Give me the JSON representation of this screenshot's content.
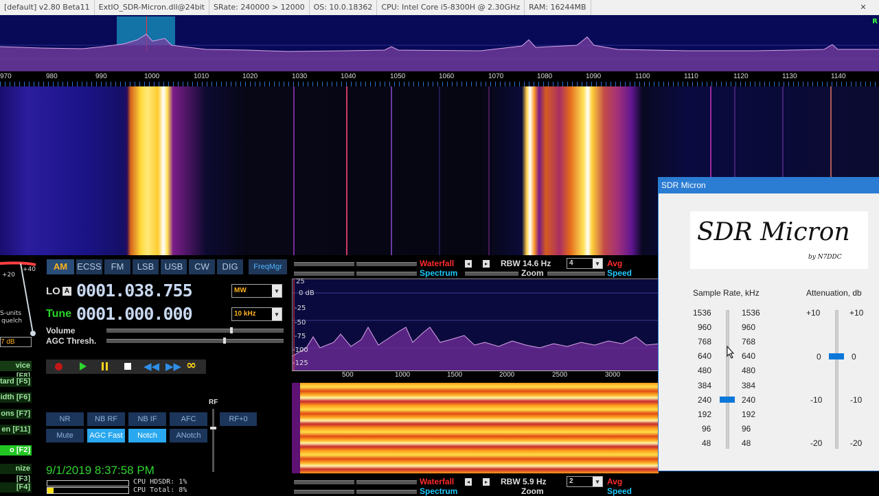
{
  "titlebar": {
    "segments": [
      "[default]  v2.80 Beta11",
      "ExtIO_SDR-Micron.dll@24bit",
      "SRate: 240000 > 12000",
      "OS: 10.0.18362",
      "CPU: Intel Core i5-8300H @ 2.30GHz",
      "RAM: 16244MB"
    ],
    "close": "✕"
  },
  "spectrum": {
    "freq_ticks": [
      "970",
      "980",
      "990",
      "1000",
      "1010",
      "1020",
      "1030",
      "1040",
      "1050",
      "1060",
      "1070",
      "1080",
      "1090",
      "1100",
      "1110",
      "1120",
      "1130",
      "1140"
    ],
    "right_marker": "R"
  },
  "smeter": {
    "scale": [
      "+20",
      "+40"
    ],
    "units_label": "S-units",
    "squelch_label": "quelch",
    "db_value": "7 dB"
  },
  "modes": [
    "AM",
    "ECSS",
    "FM",
    "LSB",
    "USB",
    "CW",
    "DIG"
  ],
  "freqmgr": "FreqMgr",
  "lo": {
    "label": "LO",
    "badge": "A",
    "value": "0001.038.755"
  },
  "tune": {
    "label": "Tune",
    "value": "0001.000.000"
  },
  "band_select": "MW",
  "step_select": "10 kHz",
  "volume_label": "Volume",
  "agc_label": "AGC Thresh.",
  "fkeys": [
    "vice [F8]",
    "tard [F5]",
    "idth [F6]",
    "ons [F7]",
    "en [F11]",
    "o [F2]",
    "nize [F3]",
    "[F4]"
  ],
  "transport_icons": [
    "record-icon",
    "play-icon",
    "pause-icon",
    "stop-icon",
    "rewind-icon",
    "fast-forward-icon",
    "loop-icon"
  ],
  "dsp_row1": [
    "NR",
    "NB RF",
    "NB IF",
    "AFC"
  ],
  "dsp_row2": [
    "Mute",
    "AGC Fast",
    "Notch",
    "ANotch"
  ],
  "rf_label": "RF",
  "rf_button": "RF+0",
  "datetime": "9/1/2019 8:37:58 PM",
  "cpu": {
    "hdsdr": "CPU HDSDR: 1%",
    "total": "CPU Total: 8%"
  },
  "upper_tools": {
    "waterfall": "Waterfall",
    "spectrum": "Spectrum",
    "rbw": "RBW 14.6 Hz",
    "zoom": "Zoom",
    "avg_value": "4",
    "avg": "Avg",
    "speed": "Speed"
  },
  "lower_tools": {
    "waterfall": "Waterfall",
    "spectrum": "Spectrum",
    "rbw": "RBW  5.9 Hz",
    "zoom": "Zoom",
    "avg_value": "2",
    "avg": "Avg",
    "speed": "Speed"
  },
  "audio_spectrum": {
    "db_labels": [
      "25",
      "0 dB",
      "-25",
      "-50",
      "-75",
      "-100",
      "-125"
    ],
    "freq_ticks": [
      "500",
      "1000",
      "1500",
      "2000",
      "2500",
      "3000"
    ]
  },
  "dialog": {
    "title": "SDR Micron",
    "logo_text": "SDR Micron",
    "logo_sub": "by N7DDC",
    "sample_rate_label": "Sample Rate, kHz",
    "attenuation_label": "Attenuation, db",
    "sample_rates": [
      "1536",
      "960",
      "768",
      "640",
      "480",
      "384",
      "240",
      "192",
      "96",
      "48"
    ],
    "sample_rate_selected": "240",
    "attenuations": [
      "+10",
      "0",
      "-10",
      "-20"
    ],
    "attenuation_selected": "0"
  },
  "colors": {
    "accent": "#2b7cd3",
    "mode_active": "#ffb21c",
    "wf_red": "#ff2a2a",
    "wf_cyan": "#1ecbff",
    "dsp_on": "#2aa8ef"
  }
}
